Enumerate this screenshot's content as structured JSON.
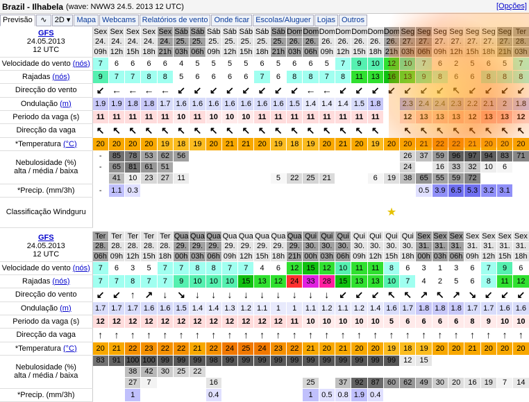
{
  "title": "Brazil - Ilhabela",
  "subtitle": "(wave: NWW3 24.5. 2013 12 UTC)",
  "opcoes": "[Opções]",
  "tabs": [
    "Previsão",
    "∿",
    "2D ▾",
    "Mapa",
    "Webcams",
    "Relatórios de vento",
    "Onde ficar",
    "Escolas/Aluguer",
    "Lojas",
    "Outros"
  ],
  "model": {
    "name": "GFS",
    "date": "24.05.2013",
    "time": "12 UTC"
  },
  "labels": {
    "wind": "Velocidade do vento",
    "gust": "Rajadas",
    "knots": "(nós)",
    "winddir": "Direcção do vento",
    "wave": "Ondulação",
    "wave_unit": "(m)",
    "period": "Periodo da vaga (s)",
    "wavedir": "Direcção da vaga",
    "temp": "*Temperatura",
    "temp_unit": "(°C)",
    "cloud1": "Nebulosidade (%)",
    "cloud2": "alta / média / baixa",
    "precip": "*Precip. (mm/3h)",
    "rating": "Classificação Windguru"
  },
  "colors": {
    "wind_low": "#ffffff",
    "wind_mid": "#7ff6e8",
    "wind_high": "#00e040",
    "wind_top": "#ff3030",
    "temp": "#f5a200",
    "wave": "#c0c8f8",
    "period": "#ffd0d0"
  },
  "block1": {
    "days": [
      "Sex",
      "Sex",
      "Sex",
      "Sex",
      "Sex",
      "Sáb",
      "Sáb",
      "Sáb",
      "Sáb",
      "Sáb",
      "Sáb",
      "Sáb",
      "Dom",
      "Dom",
      "Dom",
      "Dom",
      "Dom",
      "Dom",
      "Dom",
      "Seg",
      "Seg",
      "Seg",
      "Seg",
      "Seg",
      "Seg",
      "Seg",
      "Ter"
    ],
    "dates": [
      "24.",
      "24.",
      "24.",
      "24.",
      "24.",
      "25.",
      "25.",
      "25.",
      "25.",
      "25.",
      "25.",
      "25.",
      "26.",
      "26.",
      "26.",
      "26.",
      "26.",
      "26.",
      "26.",
      "27.",
      "27.",
      "27.",
      "27.",
      "27.",
      "27.",
      "27.",
      "28."
    ],
    "hours": [
      "09h",
      "12h",
      "15h",
      "18h",
      "21h",
      "03h",
      "06h",
      "09h",
      "12h",
      "15h",
      "18h",
      "21h",
      "03h",
      "06h",
      "09h",
      "12h",
      "15h",
      "18h",
      "21h",
      "03h",
      "06h",
      "09h",
      "12h",
      "15h",
      "18h",
      "21h",
      "03h"
    ],
    "wind": [
      "7",
      "6",
      "6",
      "6",
      "6",
      "4",
      "5",
      "5",
      "5",
      "5",
      "6",
      "5",
      "6",
      "6",
      "5",
      "7",
      "9",
      "10",
      "12",
      "10",
      "7",
      "6",
      "2",
      "5",
      "6",
      "5",
      "7"
    ],
    "gust": [
      "9",
      "7",
      "7",
      "8",
      "8",
      "5",
      "6",
      "6",
      "6",
      "6",
      "7",
      "6",
      "8",
      "8",
      "7",
      "8",
      "11",
      "13",
      "16",
      "13",
      "9",
      "8",
      "6",
      "6",
      "8",
      "8",
      "8"
    ],
    "winddir": [
      "↙",
      "←",
      "←",
      "←",
      "←",
      "↙",
      "↙",
      "↙",
      "↙",
      "↙",
      "↙",
      "↙",
      "↙",
      "←",
      "←",
      "↙",
      "↙",
      "↙",
      "↙",
      "↙",
      "↙",
      "↙",
      "↖",
      "↙",
      "↙",
      "↙",
      "↙"
    ],
    "wave": [
      "1.9",
      "1.9",
      "1.8",
      "1.8",
      "1.7",
      "1.6",
      "1.6",
      "1.6",
      "1.6",
      "1.6",
      "1.6",
      "1.6",
      "1.5",
      "1.4",
      "1.4",
      "1.4",
      "1.5",
      "1.8",
      "",
      "2.3",
      "2.4",
      "2.4",
      "2.3",
      "2.2",
      "2.1",
      "2",
      "1.8"
    ],
    "period": [
      "11",
      "11",
      "11",
      "11",
      "11",
      "10",
      "11",
      "10",
      "10",
      "10",
      "11",
      "11",
      "11",
      "11",
      "11",
      "11",
      "11",
      "11",
      "",
      "12",
      "13",
      "13",
      "13",
      "12",
      "13",
      "13",
      "12"
    ],
    "wavedir": [
      "↖",
      "↖",
      "↖",
      "↖",
      "↖",
      "↖",
      "↖",
      "↖",
      "↖",
      "↖",
      "↖",
      "↖",
      "↖",
      "↖",
      "↖",
      "↖",
      "↖",
      "↖",
      "",
      "↖",
      "↖",
      "↖",
      "↖",
      "↖",
      "↖",
      "↖",
      "↖"
    ],
    "temp": [
      "20",
      "20",
      "20",
      "20",
      "19",
      "18",
      "19",
      "20",
      "21",
      "21",
      "20",
      "19",
      "18",
      "19",
      "20",
      "21",
      "20",
      "19",
      "20",
      "20",
      "21",
      "22",
      "22",
      "21",
      "20",
      "20",
      "20"
    ],
    "cloud_h": [
      "-",
      "85",
      "78",
      "53",
      "62",
      "56",
      "",
      "",
      "",
      "",
      "",
      "",
      "",
      "",
      "",
      "",
      "",
      "",
      "",
      "26",
      "37",
      "59",
      "96",
      "97",
      "94",
      "83",
      "71"
    ],
    "cloud_m": [
      "-",
      "65",
      "81",
      "61",
      "51",
      "",
      "",
      "",
      "",
      "",
      "",
      "",
      "",
      "",
      "",
      "",
      "",
      "",
      "",
      "24",
      "",
      "16",
      "33",
      "32",
      "10",
      "6",
      ""
    ],
    "cloud_l": [
      "",
      "41",
      "10",
      "23",
      "27",
      "11",
      "",
      "",
      "",
      "",
      "",
      "5",
      "22",
      "25",
      "21",
      "",
      "",
      "6",
      "19",
      "38",
      "65",
      "55",
      "59",
      "72",
      "",
      "",
      ""
    ],
    "precip": [
      "-",
      "1.1",
      "0.3",
      "",
      "",
      "",
      "",
      "",
      "",
      "",
      "",
      "",
      "",
      "",
      "",
      "",
      "",
      "",
      "",
      "",
      "0.5",
      "3.9",
      "6.5",
      "5.3",
      "3.2",
      "3.1",
      ""
    ],
    "rating": [
      "",
      "",
      "",
      "",
      "",
      "",
      "",
      "",
      "",
      "",
      "",
      "",
      "",
      "",
      "",
      "",
      "",
      "",
      "★",
      "",
      "",
      "",
      "",
      "",
      "",
      "",
      ""
    ]
  },
  "block2": {
    "days": [
      "Ter",
      "Ter",
      "Ter",
      "Ter",
      "Ter",
      "Qua",
      "Qua",
      "Qua",
      "Qua",
      "Qua",
      "Qua",
      "Qua",
      "Qua",
      "Qui",
      "Qui",
      "Qui",
      "Qui",
      "Qui",
      "Qui",
      "Qui",
      "Sex",
      "Sex",
      "Sex",
      "Sex",
      "Sex",
      "Sex",
      "Sex"
    ],
    "dates": [
      "28.",
      "28.",
      "28.",
      "28.",
      "28.",
      "29.",
      "29.",
      "29.",
      "29.",
      "29.",
      "29.",
      "29.",
      "29.",
      "30.",
      "30.",
      "30.",
      "30.",
      "30.",
      "30.",
      "30.",
      "31.",
      "31.",
      "31.",
      "31.",
      "31.",
      "31.",
      "31."
    ],
    "hours": [
      "06h",
      "09h",
      "12h",
      "15h",
      "18h",
      "00h",
      "03h",
      "06h",
      "09h",
      "12h",
      "15h",
      "18h",
      "21h",
      "00h",
      "03h",
      "06h",
      "09h",
      "12h",
      "15h",
      "18h",
      "00h",
      "03h",
      "06h",
      "09h",
      "12h",
      "15h",
      "18h"
    ],
    "wind": [
      "7",
      "6",
      "3",
      "5",
      "7",
      "7",
      "8",
      "8",
      "7",
      "7",
      "4",
      "6",
      "12",
      "15",
      "12",
      "10",
      "11",
      "11",
      "8",
      "6",
      "3",
      "1",
      "3",
      "6",
      "7",
      "9",
      "6"
    ],
    "gust": [
      "7",
      "7",
      "8",
      "7",
      "7",
      "9",
      "10",
      "10",
      "10",
      "15",
      "13",
      "12",
      "24",
      "33",
      "28",
      "15",
      "13",
      "13",
      "10",
      "7",
      "4",
      "2",
      "5",
      "6",
      "8",
      "11",
      "12"
    ],
    "winddir": [
      "↙",
      "↙",
      "↑",
      "↗",
      "↓",
      "↘",
      "↓",
      "↓",
      "↓",
      "↓",
      "↓",
      "↓",
      "↓",
      "↓",
      "↓",
      "↙",
      "↙",
      "↙",
      "↖",
      "↖",
      "↗",
      "↖",
      "↗",
      "↘",
      "↙",
      "↙",
      "↙"
    ],
    "wave": [
      "1.7",
      "1.7",
      "1.7",
      "1.6",
      "1.6",
      "1.5",
      "1.4",
      "1.4",
      "1.3",
      "1.2",
      "1.1",
      "1",
      "1",
      "1.1",
      "1.2",
      "1.1",
      "1.2",
      "1.4",
      "1.6",
      "1.7",
      "1.8",
      "1.8",
      "1.8",
      "1.7",
      "1.7",
      "1.6",
      "1.6"
    ],
    "period": [
      "12",
      "12",
      "12",
      "12",
      "12",
      "12",
      "12",
      "12",
      "12",
      "12",
      "12",
      "12",
      "11",
      "10",
      "10",
      "10",
      "10",
      "10",
      "5",
      "6",
      "6",
      "6",
      "6",
      "8",
      "9",
      "10",
      "10"
    ],
    "wavedir": [
      "↑",
      "↑",
      "↑",
      "↑",
      "↑",
      "↑",
      "↑",
      "↑",
      "↑",
      "↑",
      "↑",
      "↑",
      "↑",
      "↑",
      "↑",
      "↑",
      "↑",
      "↑",
      "↑",
      "↑",
      "↑",
      "↑",
      "↑",
      "↑",
      "↑",
      "↑",
      "↑"
    ],
    "temp": [
      "20",
      "21",
      "22",
      "23",
      "22",
      "22",
      "21",
      "22",
      "24",
      "25",
      "24",
      "23",
      "22",
      "21",
      "20",
      "21",
      "20",
      "20",
      "19",
      "18",
      "19",
      "20",
      "20",
      "21",
      "20",
      "20",
      "20"
    ],
    "cloud_h": [
      "83",
      "91",
      "100",
      "100",
      "99",
      "99",
      "99",
      "98",
      "99",
      "99",
      "99",
      "99",
      "99",
      "99",
      "99",
      "99",
      "99",
      "99",
      "99",
      "12",
      "15",
      "",
      "",
      "",
      "",
      "",
      ""
    ],
    "cloud_m": [
      "",
      "",
      "38",
      "42",
      "30",
      "25",
      "22",
      "",
      "",
      "",
      "",
      "",
      "",
      "",
      "",
      "",
      "",
      "",
      "",
      "",
      "",
      "",
      "",
      "",
      "",
      "",
      ""
    ],
    "cloud_l": [
      "",
      "",
      "27",
      "7",
      "",
      "",
      "",
      "16",
      "",
      "",
      "",
      "",
      "",
      "25",
      "",
      "37",
      "92",
      "87",
      "60",
      "62",
      "49",
      "30",
      "20",
      "16",
      "19",
      "7",
      "14"
    ],
    "precip": [
      "",
      "",
      "1",
      "",
      "",
      "",
      "",
      "0.4",
      "",
      "",
      "",
      "",
      "",
      "1",
      "0.5",
      "0.8",
      "1.9",
      "0.4",
      "",
      "",
      "",
      "",
      "",
      "",
      "",
      "",
      ""
    ]
  }
}
